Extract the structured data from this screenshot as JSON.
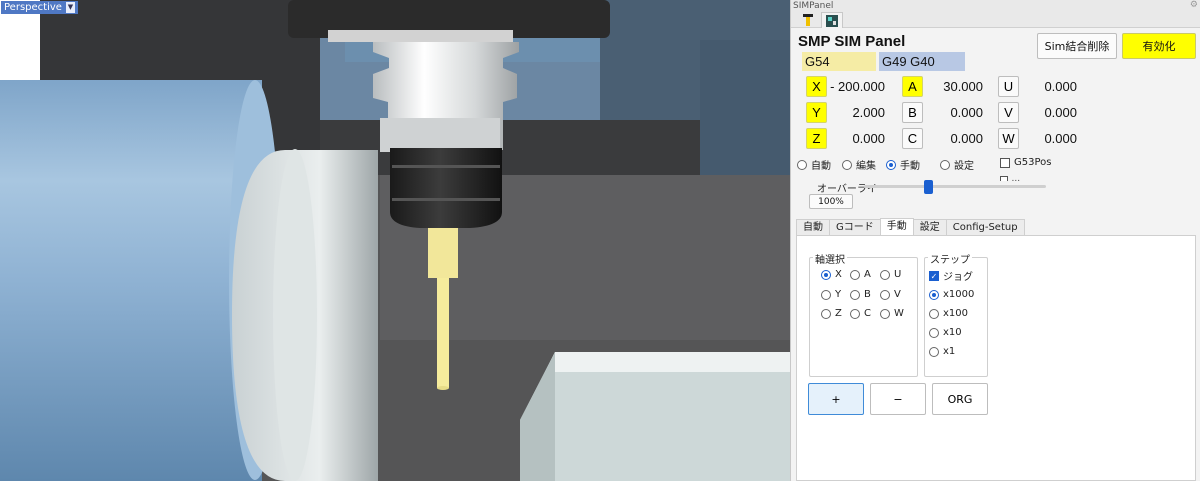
{
  "viewport": {
    "label": "Perspective",
    "dropdown_glyph": "▼"
  },
  "panel": {
    "window_title": "SIMPanel",
    "title": "SMP SIM Panel",
    "sim_delete_label": "Sim結合削除",
    "enable_label": "有効化",
    "work_coord": "G54",
    "modal_codes": "G49 G40",
    "axes": [
      {
        "name": "X",
        "value": "- 200.000",
        "highlight": true
      },
      {
        "name": "Y",
        "value": "2.000",
        "highlight": true
      },
      {
        "name": "Z",
        "value": "0.000",
        "highlight": true
      },
      {
        "name": "A",
        "value": "30.000",
        "highlight": true
      },
      {
        "name": "B",
        "value": "0.000",
        "highlight": false
      },
      {
        "name": "C",
        "value": "0.000",
        "highlight": false
      },
      {
        "name": "U",
        "value": "0.000",
        "highlight": false
      },
      {
        "name": "V",
        "value": "0.000",
        "highlight": false
      },
      {
        "name": "W",
        "value": "0.000",
        "highlight": false
      }
    ],
    "modes": [
      {
        "label": "自動",
        "selected": false
      },
      {
        "label": "編集",
        "selected": false
      },
      {
        "label": "手動",
        "selected": true
      },
      {
        "label": "設定",
        "selected": false
      }
    ],
    "g53pos_label": "G53Pos",
    "g53pos_checked": false,
    "hidden_option_label": "...",
    "override_label": "オーバーライ",
    "override_value": "100%",
    "override_level_percent": 35,
    "tabs": [
      "自動",
      "Gコード",
      "手動",
      "設定",
      "Config-Setup"
    ],
    "active_tab": "手動",
    "axis_select_label": "軸選択",
    "axis_select_options": [
      [
        "X",
        "A",
        "U"
      ],
      [
        "Y",
        "B",
        "V"
      ],
      [
        "Z",
        "C",
        "W"
      ]
    ],
    "axis_selected": "X",
    "step_label": "ステップ",
    "jog_label": "ジョグ",
    "jog_checked": true,
    "steps": [
      {
        "label": "x1000",
        "selected": true
      },
      {
        "label": "x100",
        "selected": false
      },
      {
        "label": "x10",
        "selected": false
      },
      {
        "label": "x1",
        "selected": false
      }
    ],
    "plus_label": "+",
    "minus_label": "−",
    "org_label": "ORG"
  },
  "colors": {
    "highlight_yellow": "#ffff00",
    "accent_blue": "#1a5fd0",
    "g54_bg": "#f5eca5",
    "modal_bg": "#b8c8e4"
  }
}
